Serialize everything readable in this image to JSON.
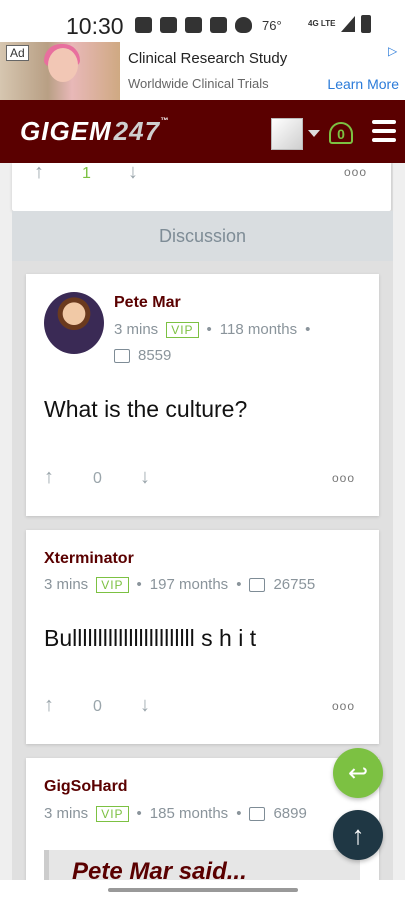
{
  "status": {
    "time": "10:30",
    "temperature": "76°",
    "network": "4G LTE",
    "icons": [
      "game-icon",
      "radio-icon",
      "facebook-icon",
      "image-icon",
      "heart-icon"
    ]
  },
  "ad": {
    "badge": "Ad",
    "title": "Clinical Research Study",
    "subtitle": "Worldwide Clinical Trials",
    "cta": "Learn More"
  },
  "header": {
    "logo_word": "GIGEM",
    "logo_number": "247",
    "logo_tm": "™",
    "notification_count": "0"
  },
  "top_card": {
    "vote_count": "1",
    "more": "ooo"
  },
  "discussion_label": "Discussion",
  "posts": [
    {
      "author": "Pete Mar",
      "time": "3 mins",
      "badge": "VIP",
      "tenure": "118 months",
      "comments": "8559",
      "body": "What is the culture?",
      "votes": "0",
      "more": "ooo"
    },
    {
      "author": "Xterminator",
      "time": "3 mins",
      "badge": "VIP",
      "tenure": "197 months",
      "comments": "26755",
      "body": "Bullllllllllllllllllllllll s h i t",
      "votes": "0",
      "more": "ooo"
    },
    {
      "author": "GigSoHard",
      "time": "3 mins",
      "badge": "VIP",
      "tenure": "185 months",
      "comments": "6899",
      "quote": "Pete Mar said..."
    }
  ],
  "colors": {
    "brand": "#5a0000",
    "accent_green": "#7cc142",
    "fab_dark": "#1f3744"
  }
}
